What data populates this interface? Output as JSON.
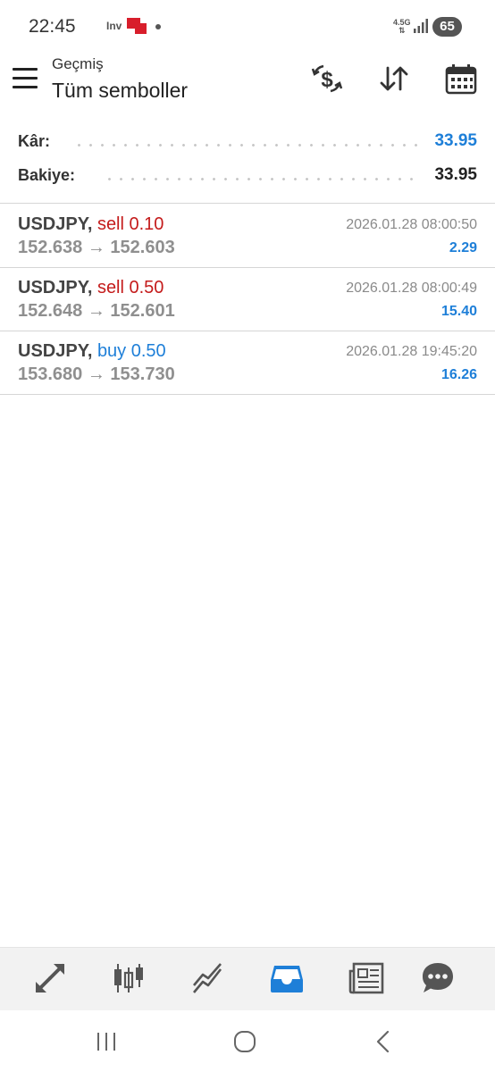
{
  "status_bar": {
    "time": "22:45",
    "notif_app": "Inv",
    "network": "4.5G",
    "battery": "65"
  },
  "header": {
    "subtitle": "Geçmiş",
    "title": "Tüm semboller"
  },
  "summary": {
    "profit_label": "Kâr:",
    "profit_value": "33.95",
    "balance_label": "Bakiye:",
    "balance_value": "33.95"
  },
  "trades": [
    {
      "symbol": "USDJPY,",
      "side": "sell 0.10",
      "prices": "152.638 → 152.603",
      "time": "2026.01.28 08:00:50",
      "profit": "2.29"
    },
    {
      "symbol": "USDJPY,",
      "side": "sell 0.50",
      "prices": "152.648 → 152.601",
      "time": "2026.01.28 08:00:49",
      "profit": "15.40"
    },
    {
      "symbol": "USDJPY,",
      "side": "buy 0.50",
      "prices": "153.680 → 153.730",
      "time": "2026.01.28 19:45:20",
      "profit": "16.26"
    }
  ],
  "tabs": [
    "quotes-icon",
    "chart-icon",
    "trade-icon",
    "history-icon",
    "news-icon",
    "chat-icon"
  ],
  "colors": {
    "accent": "#1e7fd8",
    "sell": "#c41b1b",
    "buy": "#1e7fd8",
    "muted": "#8f8f8f",
    "tabbar_bg": "#f2f2f2"
  }
}
